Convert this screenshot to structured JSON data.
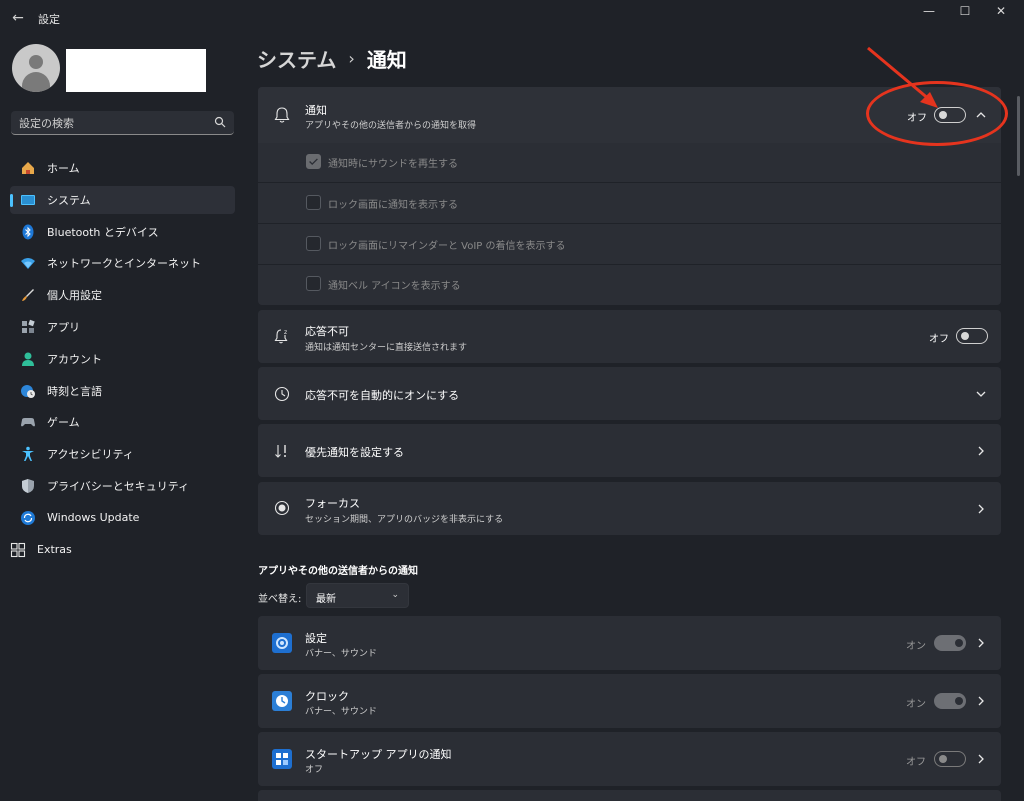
{
  "window": {
    "title": "設定",
    "controls": {
      "minimize": "—",
      "maximize": "☐",
      "close": "✕"
    }
  },
  "sidebar": {
    "search_placeholder": "設定の検索",
    "items": [
      {
        "label": "ホーム",
        "icon": "home-icon",
        "active": false
      },
      {
        "label": "システム",
        "icon": "system-icon",
        "active": true
      },
      {
        "label": "Bluetooth とデバイス",
        "icon": "bluetooth-icon",
        "active": false
      },
      {
        "label": "ネットワークとインターネット",
        "icon": "network-icon",
        "active": false
      },
      {
        "label": "個人用設定",
        "icon": "brush-icon",
        "active": false
      },
      {
        "label": "アプリ",
        "icon": "apps-icon",
        "active": false
      },
      {
        "label": "アカウント",
        "icon": "account-icon",
        "active": false
      },
      {
        "label": "時刻と言語",
        "icon": "globe-clock-icon",
        "active": false
      },
      {
        "label": "ゲーム",
        "icon": "gamepad-icon",
        "active": false
      },
      {
        "label": "アクセシビリティ",
        "icon": "accessibility-icon",
        "active": false
      },
      {
        "label": "プライバシーとセキュリティ",
        "icon": "shield-icon",
        "active": false
      },
      {
        "label": "Windows Update",
        "icon": "update-icon",
        "active": false
      },
      {
        "label": "Extras",
        "icon": "extras-icon",
        "active": false
      }
    ]
  },
  "breadcrumb": {
    "parent": "システム",
    "separator": "›",
    "current": "通知"
  },
  "notifications": {
    "title": "通知",
    "subtitle": "アプリやその他の送信者からの通知を取得",
    "toggle_label": "オフ",
    "toggle_on": false,
    "options": [
      {
        "label": "通知時にサウンドを再生する",
        "checked": true
      },
      {
        "label": "ロック画面に通知を表示する",
        "checked": false
      },
      {
        "label": "ロック画面にリマインダーと VoIP の着信を表示する",
        "checked": false
      },
      {
        "label": "通知ベル アイコンを表示する",
        "checked": false
      }
    ]
  },
  "dnd": {
    "title": "応答不可",
    "subtitle": "通知は通知センターに直接送信されます",
    "toggle_label": "オフ",
    "toggle_on": false
  },
  "auto_dnd": {
    "title": "応答不可を自動的にオンにする"
  },
  "priority": {
    "title": "優先通知を設定する"
  },
  "focus": {
    "title": "フォーカス",
    "subtitle": "セッション期間、アプリのバッジを非表示にする"
  },
  "senders": {
    "heading": "アプリやその他の送信者からの通知",
    "sort_label": "並べ替え:",
    "sort_value": "最新",
    "apps": [
      {
        "name": "設定",
        "detail": "バナー、サウンド",
        "state": "オン",
        "on": true,
        "icon": "settings-gear-icon"
      },
      {
        "name": "クロック",
        "detail": "バナー、サウンド",
        "state": "オン",
        "on": true,
        "icon": "clock-icon"
      },
      {
        "name": "スタートアップ アプリの通知",
        "detail": "オフ",
        "state": "オフ",
        "on": false,
        "icon": "startup-apps-icon"
      }
    ]
  },
  "colors": {
    "accent": "#4cc2ff",
    "annotation": "#e5341e"
  }
}
